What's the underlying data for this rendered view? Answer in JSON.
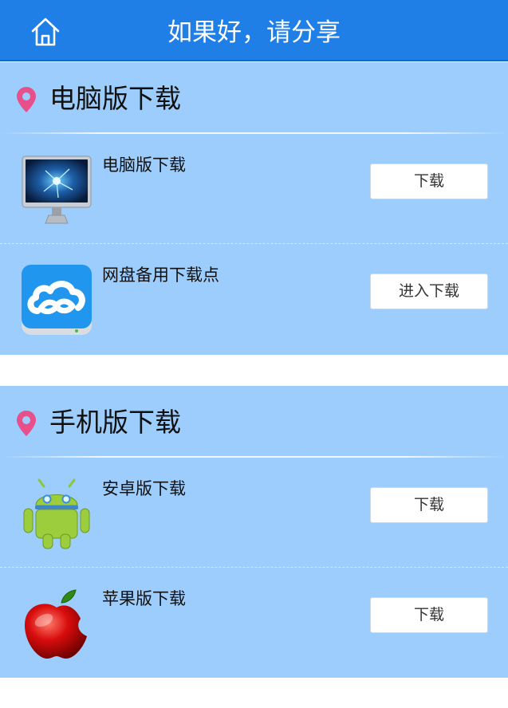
{
  "header": {
    "title": "如果好，请分享",
    "home_icon": "home-icon"
  },
  "sections": [
    {
      "title": "电脑版下载",
      "icon": "location-pin-icon",
      "items": [
        {
          "label": "电脑版下载",
          "icon": "monitor-icon",
          "button": "下载"
        },
        {
          "label": "网盘备用下载点",
          "icon": "cloud-drive-icon",
          "button": "进入下载"
        }
      ]
    },
    {
      "title": "手机版下载",
      "icon": "location-pin-icon",
      "items": [
        {
          "label": "安卓版下载",
          "icon": "android-icon",
          "button": "下载"
        },
        {
          "label": "苹果版下载",
          "icon": "apple-icon",
          "button": "下载"
        }
      ]
    }
  ],
  "colors": {
    "header_bg": "#1f7fe6",
    "section_bg": "#9ccdfc",
    "pin": "#e8508c"
  }
}
